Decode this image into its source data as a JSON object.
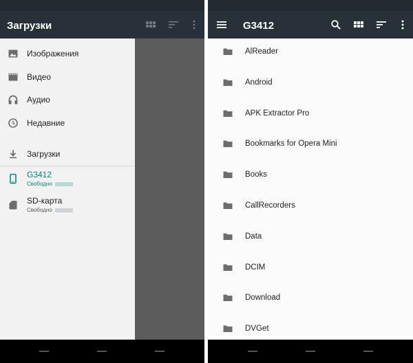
{
  "left_screen": {
    "drawer": {
      "title": "Загрузки",
      "items": [
        {
          "label": "Изображения",
          "icon": "image-icon"
        },
        {
          "label": "Видео",
          "icon": "video-icon"
        },
        {
          "label": "Аудио",
          "icon": "headphones-icon"
        },
        {
          "label": "Недавние",
          "icon": "clock-icon"
        },
        {
          "label": "Загрузки",
          "icon": "download-icon"
        },
        {
          "label": "G3412",
          "sub": "Свободно",
          "icon": "phone-icon",
          "active": true
        },
        {
          "label": "SD-карта",
          "sub": "Свободно",
          "icon": "sd-card-icon"
        }
      ]
    }
  },
  "right_screen": {
    "appbar": {
      "title": "G3412"
    },
    "files": [
      {
        "name": "AlReader"
      },
      {
        "name": "Android"
      },
      {
        "name": "APK Extractor Pro"
      },
      {
        "name": "Bookmarks for Opera Mini"
      },
      {
        "name": "Books"
      },
      {
        "name": "CallRecorders"
      },
      {
        "name": "Data"
      },
      {
        "name": "DCIM"
      },
      {
        "name": "Download"
      },
      {
        "name": "DVGet"
      }
    ]
  },
  "colors": {
    "appbar": "#263238",
    "accent": "#00897b",
    "drawer_bg": "#f2f2f2",
    "icon_gray": "#6d6d6d"
  }
}
